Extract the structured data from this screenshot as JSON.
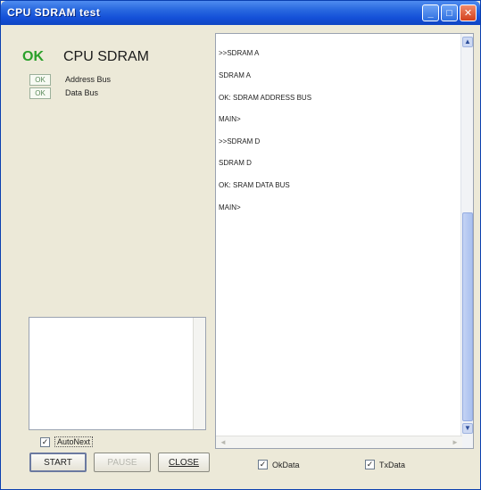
{
  "window": {
    "title": "CPU SDRAM test",
    "buttons": {
      "minimize": "_",
      "maximize": "□",
      "close": "✕"
    }
  },
  "left": {
    "main_status": "OK",
    "main_title": "CPU SDRAM",
    "tests": [
      {
        "status": "OK",
        "label": "Address Bus"
      },
      {
        "status": "OK",
        "label": "Data Bus"
      }
    ],
    "autonext": {
      "label": "AutoNext",
      "checked": true,
      "mark": "✓"
    },
    "buttons": {
      "start": "START",
      "pause": "PAUSE",
      "close": "CLOSE"
    }
  },
  "output": {
    "lines": [
      ">>SDRAM A",
      "SDRAM A",
      "OK: SDRAM ADDRESS BUS",
      "MAIN>",
      ">>SDRAM D",
      "SDRAM D",
      "OK: SRAM DATA BUS",
      "MAIN>"
    ],
    "scroll": {
      "up": "▲",
      "down": "▼",
      "left": "◄",
      "right": "►"
    }
  },
  "bottom": {
    "okdata": {
      "label": "OkData",
      "checked": true,
      "mark": "✓"
    },
    "txdata": {
      "label": "TxData",
      "checked": true,
      "mark": "✓"
    }
  },
  "colors": {
    "title_bar": "#1450d8",
    "ok_green": "#2aa02a",
    "window_bg": "#ece9d8"
  }
}
